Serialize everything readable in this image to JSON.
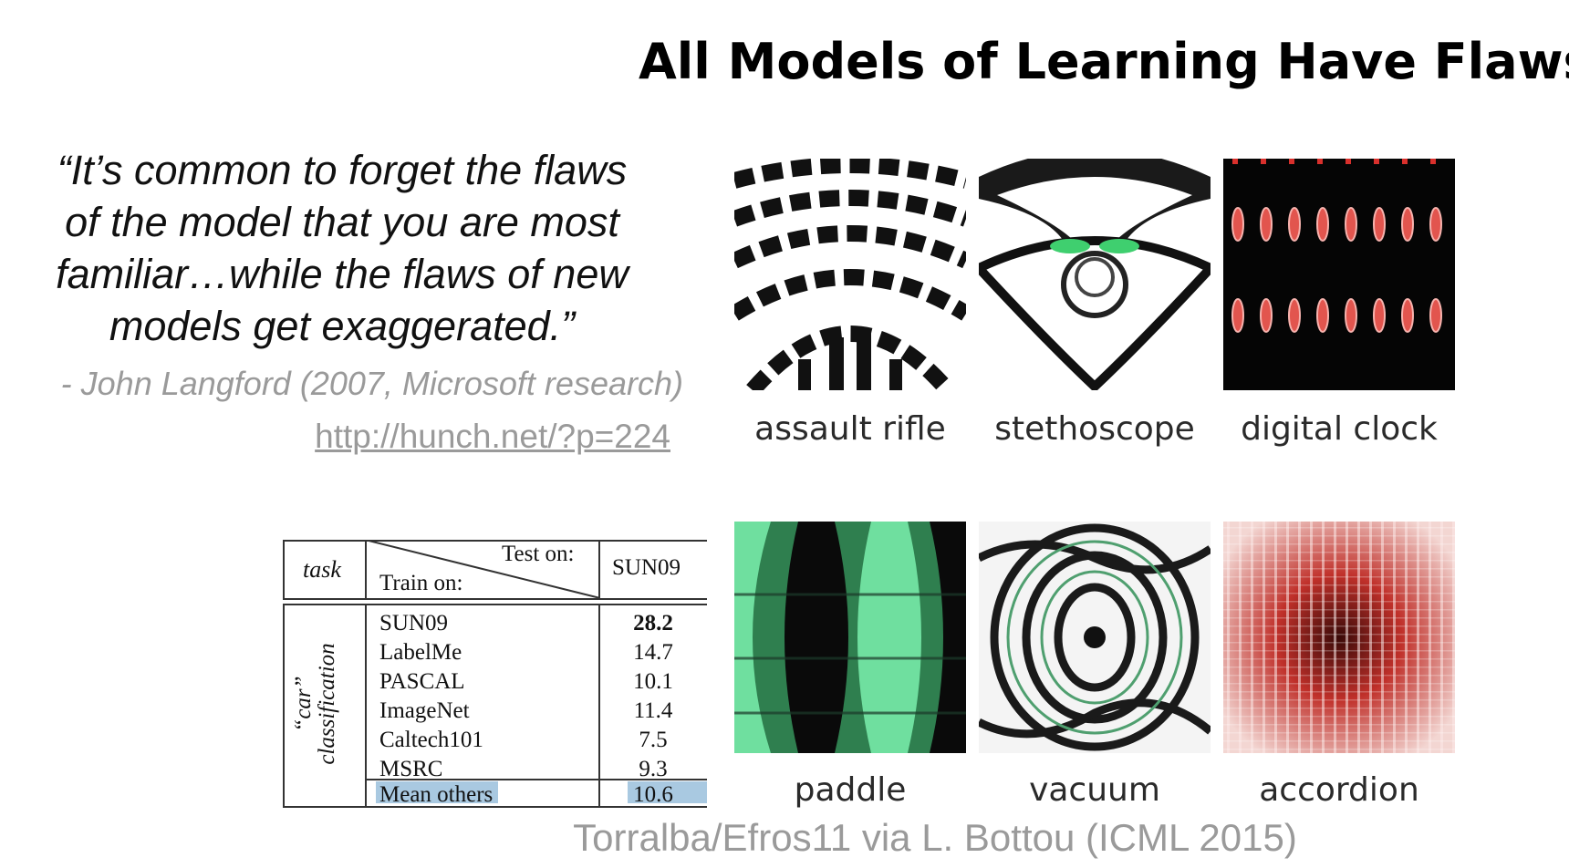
{
  "title": "All Models of Learning Have Flaws",
  "quote": {
    "lines": [
      "“It’s common to forget the flaws",
      "of the model that you are most",
      "familiar…while the flaws of new",
      "models get exaggerated.”"
    ],
    "attribution": "- John Langford (2007, Microsoft research)",
    "link": "http://hunch.net/?p=224"
  },
  "table": {
    "task_header": "task",
    "test_header": "Test on:",
    "train_header": "Train on:",
    "column": "SUN09",
    "task_label_lines": [
      "“car”",
      "classification"
    ],
    "rows": [
      {
        "train": "SUN09",
        "value": "28.2",
        "bold": true
      },
      {
        "train": "LabelMe",
        "value": "14.7"
      },
      {
        "train": "PASCAL",
        "value": "10.1"
      },
      {
        "train": "ImageNet",
        "value": "11.4"
      },
      {
        "train": "Caltech101",
        "value": "7.5"
      },
      {
        "train": "MSRC",
        "value": "9.3"
      }
    ],
    "summary": {
      "train": "Mean others",
      "value": "10.6"
    }
  },
  "images": [
    {
      "label": "assault rifle",
      "icon": "assault-rifle-pattern"
    },
    {
      "label": "stethoscope",
      "icon": "stethoscope-pattern"
    },
    {
      "label": "digital clock",
      "icon": "digital-clock-pattern"
    },
    {
      "label": "paddle",
      "icon": "paddle-pattern"
    },
    {
      "label": "vacuum",
      "icon": "vacuum-pattern"
    },
    {
      "label": "accordion",
      "icon": "accordion-pattern"
    }
  ],
  "citation": "Torralba/Efros11 via L. Bottou (ICML 2015)",
  "colors": {
    "gray_text": "#9a9a9a",
    "highlight": "#a9c9e1",
    "green": "#5fcf8f",
    "red": "#d9302c"
  }
}
